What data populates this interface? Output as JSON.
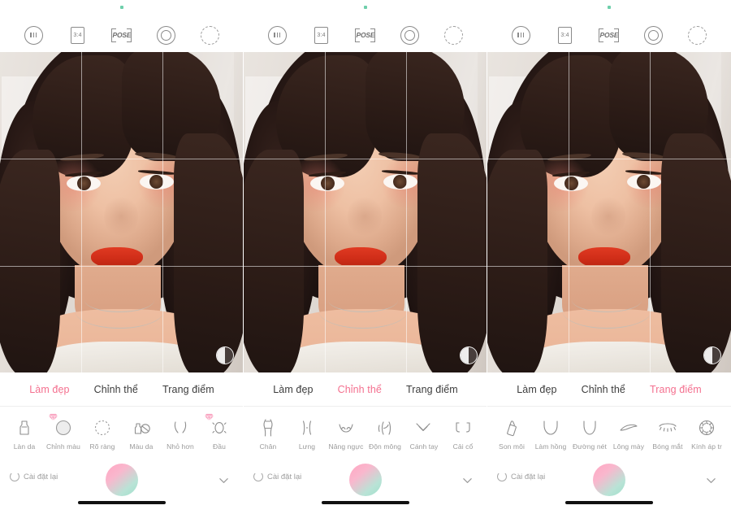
{
  "app": {
    "platform": "mobile-photo-editor",
    "accent_color": "#f4708f",
    "text_color": "#3c3c3c",
    "muted_color": "#9a9a9a"
  },
  "toolbar": {
    "icons": [
      {
        "name": "filter-strength-icon",
        "label": "|||",
        "glyph": "circle-dots"
      },
      {
        "name": "aspect-ratio-icon",
        "label": "3:4",
        "glyph": "ratio"
      },
      {
        "name": "pose-icon",
        "label": "POSE",
        "glyph": "pose"
      },
      {
        "name": "shutter-ring-icon",
        "label": "",
        "glyph": "ring"
      },
      {
        "name": "timer-dashed-icon",
        "label": "",
        "glyph": "dashring"
      }
    ]
  },
  "photo": {
    "compare_button_label": "",
    "grid_enabled": true,
    "grid_columns": 3,
    "grid_rows": 3
  },
  "panels": [
    {
      "id": "panel-1",
      "tabs": [
        {
          "label": "Làm đẹp",
          "active": true
        },
        {
          "label": "Chỉnh thể",
          "active": false
        },
        {
          "label": "Trang điểm",
          "active": false
        }
      ],
      "tools": [
        {
          "label": "Làn da",
          "icon": "skin-icon",
          "vip": false
        },
        {
          "label": "Chỉnh màu",
          "icon": "color-tone-icon",
          "vip": true
        },
        {
          "label": "Rõ ràng",
          "icon": "clarity-icon",
          "vip": false
        },
        {
          "label": "Màu da",
          "icon": "skin-color-icon",
          "vip": false
        },
        {
          "label": "Nhỏ hơn",
          "icon": "slim-face-icon",
          "vip": false
        },
        {
          "label": "Đầu",
          "icon": "head-size-icon",
          "vip": true
        }
      ],
      "reset_label": "Cài đặt lại"
    },
    {
      "id": "panel-2",
      "tabs": [
        {
          "label": "Làm đẹp",
          "active": false
        },
        {
          "label": "Chỉnh thể",
          "active": true
        },
        {
          "label": "Trang điểm",
          "active": false
        }
      ],
      "tools": [
        {
          "label": "Chân",
          "icon": "legs-icon",
          "vip": false
        },
        {
          "label": "Lưng",
          "icon": "waist-icon",
          "vip": false
        },
        {
          "label": "Nâng ngực",
          "icon": "bust-icon",
          "vip": false
        },
        {
          "label": "Độn mông",
          "icon": "hip-icon",
          "vip": false
        },
        {
          "label": "Cánh tay",
          "icon": "arm-icon",
          "vip": false
        },
        {
          "label": "Cải cổ",
          "icon": "neck-icon",
          "vip": false
        }
      ],
      "reset_label": "Cài đặt lại"
    },
    {
      "id": "panel-3",
      "tabs": [
        {
          "label": "Làm đẹp",
          "active": false
        },
        {
          "label": "Chỉnh thể",
          "active": false
        },
        {
          "label": "Trang điểm",
          "active": true
        }
      ],
      "tools": [
        {
          "label": "Son môi",
          "icon": "lipstick-icon",
          "vip": false
        },
        {
          "label": "Làm hồng",
          "icon": "blush-icon",
          "vip": false
        },
        {
          "label": "Đường nét",
          "icon": "contour-icon",
          "vip": false
        },
        {
          "label": "Lông mày",
          "icon": "eyebrow-icon",
          "vip": false
        },
        {
          "label": "Bóng mắt",
          "icon": "eyeshadow-icon",
          "vip": false
        },
        {
          "label": "Kính áp tr",
          "icon": "contacts-icon",
          "vip": false
        }
      ],
      "reset_label": "Cài đặt lại"
    }
  ]
}
